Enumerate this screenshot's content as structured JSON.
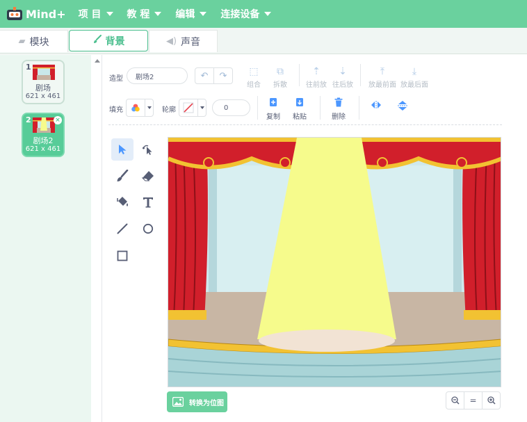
{
  "app": {
    "logo_text": "Mind+",
    "menu": [
      {
        "label": "项 目"
      },
      {
        "label": "教 程"
      },
      {
        "label": "编辑"
      },
      {
        "label": "连接设备"
      }
    ]
  },
  "tabs": [
    {
      "label": "模块",
      "icon": "blocks-icon"
    },
    {
      "label": "背景",
      "icon": "brush-icon",
      "active": true
    },
    {
      "label": "声音",
      "icon": "speaker-icon"
    }
  ],
  "backdrops": [
    {
      "index": "1",
      "name": "剧场",
      "size": "621 x 461",
      "selected": false
    },
    {
      "index": "2",
      "name": "剧场2",
      "size": "621 x 461",
      "selected": true
    }
  ],
  "toolbar": {
    "costume_label": "造型",
    "costume_name": "剧场2",
    "group_label": "组合",
    "ungroup_label": "拆散",
    "forward_label": "往前放",
    "backward_label": "往后放",
    "front_label": "放最前面",
    "back_label": "放最后面",
    "fill_label": "填充",
    "outline_label": "轮廓",
    "outline_width": "0",
    "copy_label": "复制",
    "paste_label": "粘贴",
    "delete_label": "删除"
  },
  "canvas": {
    "convert_label": "转换为位图",
    "zoom_reset_label": "="
  },
  "colors": {
    "brand": "#6ad19e",
    "accent": "#4cbf8f",
    "selected_backdrop": "#57cc98",
    "curtain": "#d11f2b",
    "spotlight": "#f6fb8c"
  }
}
